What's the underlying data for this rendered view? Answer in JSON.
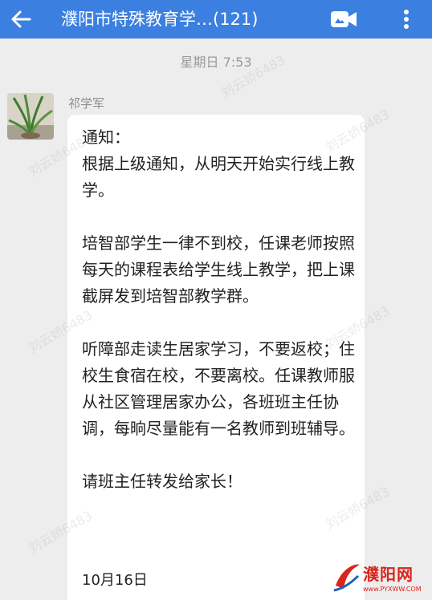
{
  "header": {
    "title": "濮阳市特殊教育学…(121)",
    "back_icon": "arrow-left-icon",
    "video_icon": "video-call-icon",
    "more_icon": "more-vertical-icon",
    "color": "#3b7fe0"
  },
  "chat": {
    "timestamp": "星期日 7:53",
    "message": {
      "sender": "祁学军",
      "text": "通知：\n根据上级通知，从明天开始实行线上教学。\n\n培智部学生一律不到校，任课老师按照每天的课程表给学生线上教学，把上课截屏发到培智部教学群。\n\n听障部走读生居家学习，不要返校；住校生食宿在校，不要离校。任课教师服从社区管理居家办公，各班班主任协调，每晌尽量能有一名教师到班辅导。\n\n请班主任转发给家长！",
      "date": "10月16日"
    }
  },
  "watermark": {
    "text": "刘云娇6483"
  },
  "logo": {
    "name": "濮阳网",
    "url": "www.PYXWW.COM"
  }
}
